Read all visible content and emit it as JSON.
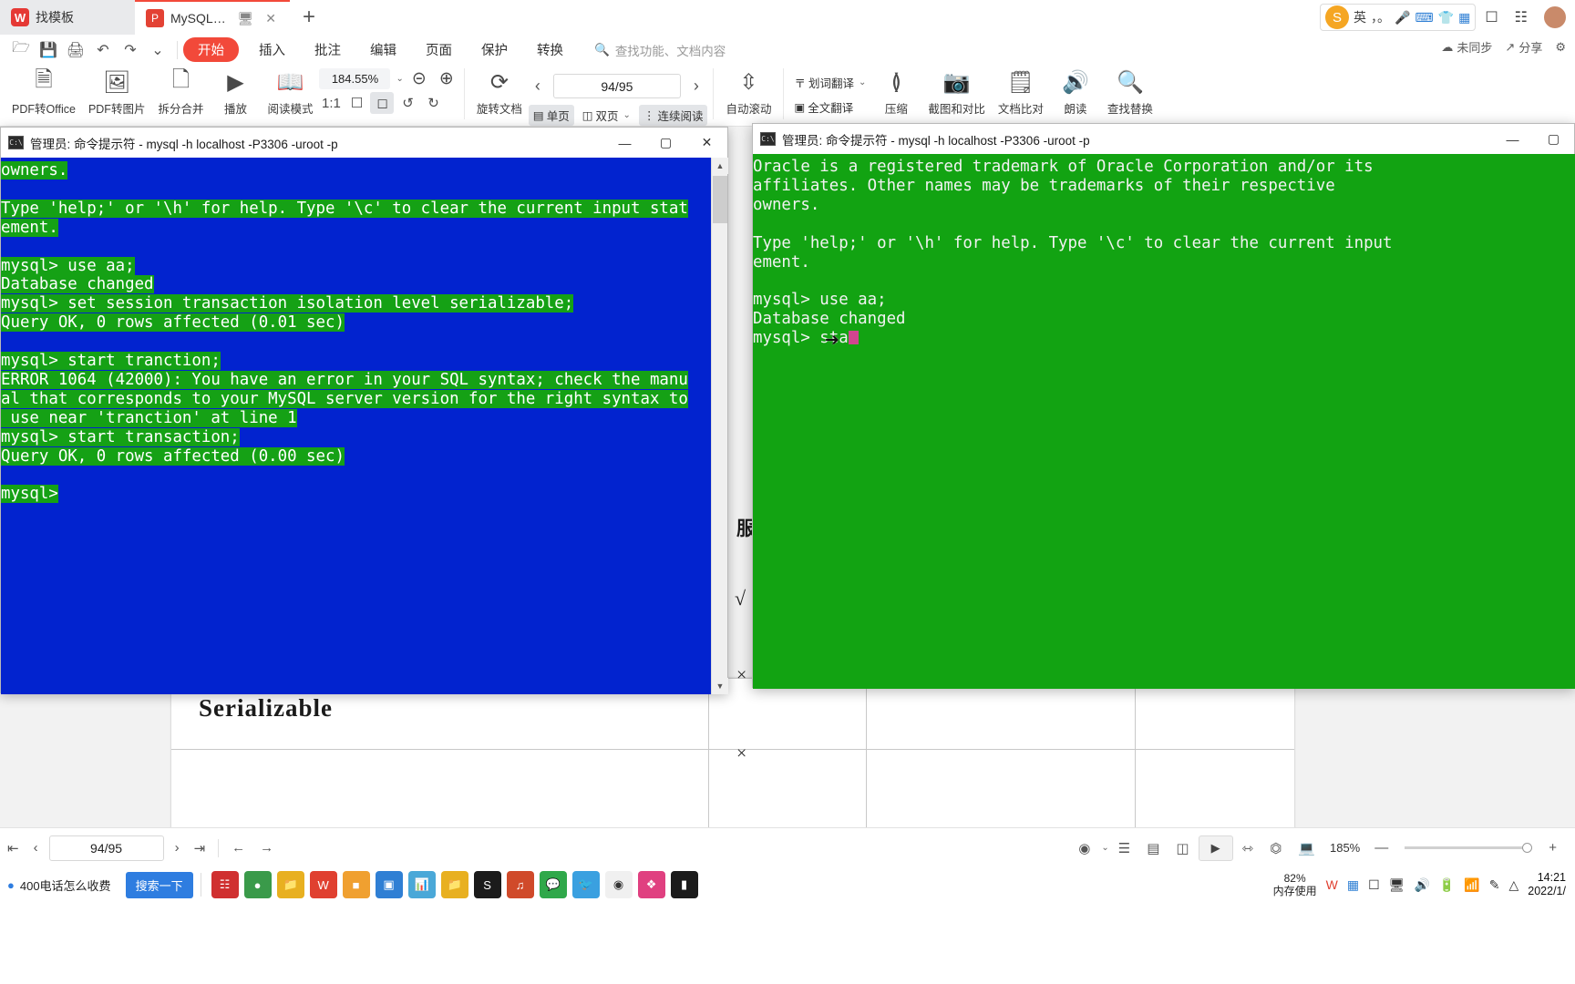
{
  "tabbar": {
    "tabs": [
      {
        "label": "找模板",
        "icon": "wps-logo-icon",
        "active": false
      },
      {
        "label": "MySQL-基础篇.pdf",
        "icon": "pdf-file-icon",
        "active": true
      }
    ],
    "new_tab_label": "+",
    "ime": {
      "logo": "sogou-logo-icon",
      "mode": "英",
      "punct": "，。",
      "mic": "microphone-icon",
      "keyboard": "keyboard-icon",
      "skin": "skin-icon",
      "apps": "apps-grid-icon"
    },
    "window_controls": [
      "restore-icon",
      "grid-icon"
    ]
  },
  "ribbon": {
    "quick_access": [
      "open-folder-icon",
      "save-icon",
      "print-icon",
      "undo-icon",
      "redo-icon",
      "chevron-down-icon"
    ],
    "menus": [
      {
        "label": "开始",
        "active": true
      },
      {
        "label": "插入",
        "active": false
      },
      {
        "label": "批注",
        "active": false
      },
      {
        "label": "编辑",
        "active": false
      },
      {
        "label": "页面",
        "active": false
      },
      {
        "label": "保护",
        "active": false
      },
      {
        "label": "转换",
        "active": false
      }
    ],
    "search_placeholder": "查找功能、文档内容",
    "right_items": [
      {
        "label": "未同步",
        "icon": "cloud-sync-icon"
      },
      {
        "label": "分享",
        "icon": "share-icon"
      },
      {
        "label": "",
        "icon": "gear-icon"
      }
    ],
    "buttons": [
      {
        "label": "PDF转Office",
        "icon": "pdf-to-office-icon",
        "dropdown": true
      },
      {
        "label": "PDF转图片",
        "icon": "pdf-to-image-icon",
        "dropdown": false
      },
      {
        "label": "拆分合并",
        "icon": "split-merge-icon",
        "dropdown": true
      },
      {
        "label": "播放",
        "icon": "play-circle-icon",
        "dropdown": false
      },
      {
        "label": "阅读模式",
        "icon": "book-icon",
        "dropdown": false
      }
    ],
    "zoom": {
      "value": "184.55%",
      "zoom_out_icon": "zoom-out-icon",
      "zoom_in_icon": "zoom-in-icon"
    },
    "view_icons": [
      "actual-size-icon",
      "fit-page-icon",
      "fit-width-icon",
      "rotate-left-icon",
      "rotate-right-icon"
    ],
    "page_nav": {
      "prev": "‹",
      "value": "94/95",
      "next": "›"
    },
    "rotate_label": "旋转文档",
    "layout_buttons": [
      {
        "label": "单页",
        "icon": "single-page-icon",
        "selected": true
      },
      {
        "label": "双页",
        "icon": "double-page-icon",
        "selected": false,
        "dropdown": true
      },
      {
        "label": "连续阅读",
        "icon": "continuous-scroll-icon",
        "selected": true
      }
    ],
    "autoscroll_label": "自动滚动",
    "translate_buttons": [
      {
        "label": "划词翻译",
        "icon": "word-translate-icon",
        "dropdown": true
      },
      {
        "label": "全文翻译",
        "icon": "full-translate-icon",
        "dropdown": false
      }
    ],
    "tools": [
      {
        "label": "压缩",
        "icon": "compress-icon"
      },
      {
        "label": "截图和对比",
        "icon": "screenshot-compare-icon"
      },
      {
        "label": "文档比对",
        "icon": "doc-compare-icon"
      },
      {
        "label": "朗读",
        "icon": "read-aloud-icon"
      },
      {
        "label": "查找替换",
        "icon": "find-replace-icon"
      }
    ]
  },
  "document": {
    "heading": "Serializable",
    "cn_heading": "服",
    "table_marks": {
      "check": "√",
      "cross": "×"
    }
  },
  "console1": {
    "title": "管理员: 命令提示符 -  mysql  -h localhost -P3306 -uroot -p",
    "icon": "console-icon",
    "window_buttons": {
      "minimize": "—",
      "maximize": "▢",
      "close": "✕"
    },
    "bg_color": "#0223cf",
    "highlight_color": "#15a115",
    "lines": [
      {
        "text": "owners.",
        "hl": true
      },
      {
        "text": "",
        "hl": false
      },
      {
        "text": "Type 'help;' or '\\h' for help. Type '\\c' to clear the current input stat",
        "hl": true
      },
      {
        "text": "ement.",
        "hl": true
      },
      {
        "text": "",
        "hl": false
      },
      {
        "text": "mysql> use aa;",
        "hl": true
      },
      {
        "text": "Database changed",
        "hl": true
      },
      {
        "text": "mysql> set session transaction isolation level serializable;",
        "hl": true
      },
      {
        "text": "Query OK, 0 rows affected (0.01 sec)",
        "hl": true
      },
      {
        "text": "",
        "hl": false
      },
      {
        "text": "mysql> start tranction;",
        "hl": true
      },
      {
        "text": "ERROR 1064 (42000): You have an error in your SQL syntax; check the manu",
        "hl": true
      },
      {
        "text": "al that corresponds to your MySQL server version for the right syntax to",
        "hl": true
      },
      {
        "text": " use near 'tranction' at line 1",
        "hl": true
      },
      {
        "text": "mysql> start transaction;",
        "hl": true
      },
      {
        "text": "Query OK, 0 rows affected (0.00 sec)",
        "hl": true
      },
      {
        "text": "",
        "hl": false
      },
      {
        "text": "mysql>",
        "hl": true
      }
    ]
  },
  "console2": {
    "title": "管理员: 命令提示符 -  mysql  -h localhost -P3306 -uroot -p",
    "icon": "console-icon",
    "window_buttons": {
      "minimize": "—",
      "maximize": "▢"
    },
    "bg_color": "#12a312",
    "cursor_color": "#d0458f",
    "lines": [
      "Oracle is a registered trademark of Oracle Corporation and/or its",
      "affiliates. Other names may be trademarks of their respective",
      "owners.",
      "",
      "Type 'help;' or '\\h' for help. Type '\\c' to clear the current input",
      "ement.",
      "",
      "mysql> use aa;",
      "Database changed"
    ],
    "prompt_line": "mysql> sta"
  },
  "bottombar": {
    "first_icon": "first-page-icon",
    "prev_icon": "prev-page-icon",
    "page_value": "94/95",
    "next_icon": "next-page-icon",
    "last_icon": "last-page-icon",
    "prev_view_icon": "prev-view-icon",
    "next_view_icon": "next-view-icon",
    "right_icons": [
      "eye-mode-icon",
      "fit-page-icon",
      "single-page-icon",
      "double-page-icon",
      "comment-icon",
      "speaker-icon",
      "play-icon",
      "fit-width-icon",
      "crop-icon",
      "laptop-icon"
    ],
    "zoom_value": "185%",
    "zoom_minus": "—",
    "zoom_plus": "+"
  },
  "taskbar": {
    "left_item": {
      "label": "400电话怎么收费",
      "icon": "globe-icon"
    },
    "search_label": "搜索一下",
    "apps": [
      "taskview-icon",
      "edge-icon",
      "explorer-icon",
      "wps-icon",
      "store-icon",
      "teams-icon",
      "chart-icon",
      "folder-icon",
      "s-icon",
      "music-icon",
      "wechat-icon",
      "qq-icon",
      "chrome-icon",
      "idea-icon",
      "console-icon"
    ],
    "memory": {
      "value": "82%",
      "label": "内存使用"
    },
    "tray": [
      "W-icon",
      "grid-icon",
      "screen-icon",
      "monitor-icon",
      "volume-icon",
      "battery-icon",
      "wifi-icon",
      "notes-icon",
      "up-arrow-icon"
    ],
    "clock": {
      "time": "14:21",
      "date": "2022/1/"
    }
  }
}
